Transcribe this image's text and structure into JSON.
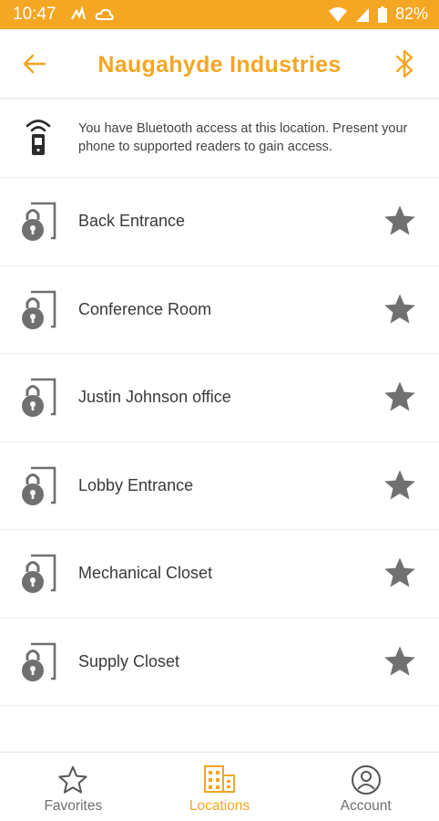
{
  "status_bar": {
    "time": "10:47",
    "battery": "82%"
  },
  "header": {
    "title": "Naugahyde Industries",
    "back_icon": "arrow-left-icon",
    "bluetooth_icon": "bluetooth-icon"
  },
  "notice": {
    "text": "You have Bluetooth access at this location. Present your phone to supported readers to gain access."
  },
  "doors": [
    {
      "label": "Back Entrance"
    },
    {
      "label": "Conference Room"
    },
    {
      "label": "Justin Johnson office"
    },
    {
      "label": "Lobby Entrance"
    },
    {
      "label": "Mechanical Closet"
    },
    {
      "label": "Supply Closet"
    }
  ],
  "nav": {
    "favorites": "Favorites",
    "locations": "Locations",
    "account": "Account",
    "active": "locations"
  },
  "colors": {
    "accent": "#f5a623",
    "icon_gray": "#707070"
  }
}
